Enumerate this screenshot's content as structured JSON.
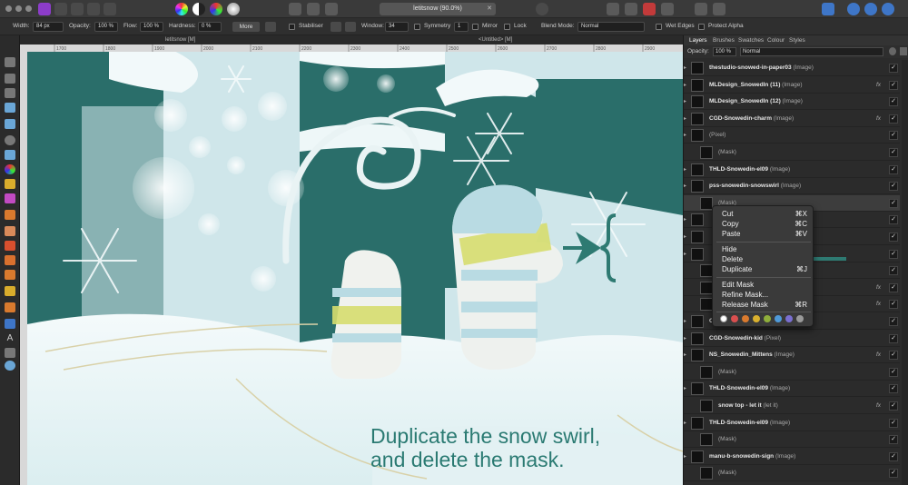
{
  "document": {
    "tab_title": "letitsnow (90.0%)",
    "canvas_title": "letitsnow [M]",
    "canvas_title_right": "<Untitled> [M]"
  },
  "context_toolbar": {
    "width_label": "Width:",
    "width_value": "84 px",
    "opacity_label": "Opacity:",
    "opacity_value": "100 %",
    "flow_label": "Flow:",
    "flow_value": "100 %",
    "hardness_label": "Hardness:",
    "hardness_value": "0 %",
    "more_label": "More",
    "stabiliser_label": "Stabiliser",
    "window_label": "Window:",
    "window_value": "34",
    "symmetry_label": "Symmetry",
    "symmetry_value": "1",
    "mirror_label": "Mirror",
    "lock_label": "Lock",
    "blend_label": "Blend Mode:",
    "blend_value": "Normal",
    "wet_edges_label": "Wet Edges",
    "protect_alpha_label": "Protect Alpha"
  },
  "ruler": {
    "ticks": [
      "1700",
      "1800",
      "1900",
      "2000",
      "2100",
      "2200",
      "2300",
      "2400",
      "2500",
      "2600",
      "2700",
      "2800",
      "2900"
    ]
  },
  "canvas": {
    "tutorial_line1": "Duplicate the snow swirl,",
    "tutorial_line2": "and delete the mask."
  },
  "context_menu": {
    "items": [
      {
        "label": "Cut",
        "shortcut": "⌘X"
      },
      {
        "label": "Copy",
        "shortcut": "⌘C"
      },
      {
        "label": "Paste",
        "shortcut": "⌘V"
      },
      {
        "label": "Hide",
        "shortcut": ""
      },
      {
        "label": "Delete",
        "shortcut": ""
      },
      {
        "label": "Duplicate",
        "shortcut": "⌘J"
      },
      {
        "label": "Edit Mask",
        "shortcut": ""
      },
      {
        "label": "Refine Mask...",
        "shortcut": ""
      },
      {
        "label": "Release Mask",
        "shortcut": "⌘R"
      }
    ],
    "swatches": [
      "#d94f4f",
      "#d97a2e",
      "#d9b02e",
      "#8fae3b",
      "#4f9ad9",
      "#7a6fd1",
      "#9a9a9a"
    ]
  },
  "panel": {
    "tabs": [
      "Layers",
      "Brushes",
      "Swatches",
      "Colour",
      "Styles"
    ],
    "opacity_label": "Opacity:",
    "opacity_value": "100 %",
    "blend_value": "Normal",
    "layers": [
      {
        "name": "thestudio-snowed-in-paper03",
        "type": "(Image)",
        "indent": 0,
        "fx": false
      },
      {
        "name": "MLDesign_SnowedIn (11)",
        "type": "(Image)",
        "indent": 0,
        "fx": true
      },
      {
        "name": "MLDesign_SnowedIn (12)",
        "type": "(Image)",
        "indent": 0,
        "fx": false
      },
      {
        "name": "CGD-Snowedin-charm",
        "type": "(Image)",
        "indent": 0,
        "fx": true
      },
      {
        "name": "",
        "type": "(Pixel)",
        "indent": 0,
        "fx": false
      },
      {
        "name": "",
        "type": "(Mask)",
        "indent": 1,
        "fx": false
      },
      {
        "name": "THLD-Snowedin-el09",
        "type": "(Image)",
        "indent": 0,
        "fx": false
      },
      {
        "name": "pss-snowedin-snowswirl",
        "type": "(Image)",
        "indent": 0,
        "fx": false
      },
      {
        "name": "",
        "type": "(Mask)",
        "indent": 1,
        "fx": false
      },
      {
        "name": "",
        "type": "",
        "indent": 0,
        "fx": false
      },
      {
        "name": "",
        "type": "",
        "indent": 0,
        "fx": false
      },
      {
        "name": "",
        "type": "",
        "indent": 0,
        "fx": false
      },
      {
        "name": "",
        "type": "",
        "indent": 1,
        "fx": false
      },
      {
        "name": "",
        "type": "",
        "indent": 1,
        "fx": true
      },
      {
        "name": "",
        "type": "",
        "indent": 1,
        "fx": true
      },
      {
        "name": "CGD-Snowedin-kid",
        "type": "(Image)",
        "indent": 0,
        "fx": false
      },
      {
        "name": "CGD-Snowedin-kid",
        "type": "(Pixel)",
        "indent": 0,
        "fx": false
      },
      {
        "name": "NS_Snowedin_Mittens",
        "type": "(Image)",
        "indent": 0,
        "fx": true
      },
      {
        "name": "",
        "type": "(Mask)",
        "indent": 1,
        "fx": false
      },
      {
        "name": "THLD-Snowedin-el09",
        "type": "(Image)",
        "indent": 0,
        "fx": false
      },
      {
        "name": "snow top - let it",
        "type": "(let it)",
        "indent": 1,
        "fx": true
      },
      {
        "name": "THLD-Snowedin-el09",
        "type": "(Image)",
        "indent": 0,
        "fx": false
      },
      {
        "name": "",
        "type": "(Mask)",
        "indent": 1,
        "fx": false
      },
      {
        "name": "manu-b-snowedin-sign",
        "type": "(Image)",
        "indent": 0,
        "fx": false
      },
      {
        "name": "",
        "type": "(Mask)",
        "indent": 1,
        "fx": false
      }
    ]
  },
  "colors": {
    "teal": "#2a6e6a",
    "annotation": "#2e7a72"
  }
}
